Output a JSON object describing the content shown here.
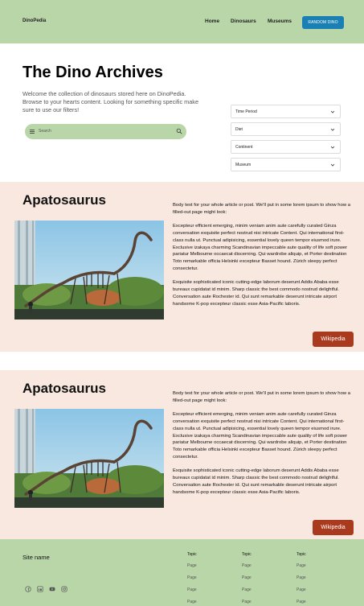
{
  "nav": {
    "brand": "DinoPedia",
    "links": [
      "Home",
      "Dinosaurs",
      "Museums"
    ],
    "cta": "RANDOM DINO"
  },
  "hero": {
    "title": "The Dino Archives",
    "description": "Welcome the collection of dinosaurs stored here on DinoPedia. Browse to your hearts content. Looking for something specific make sure to use our filters!",
    "search_placeholder": "Search",
    "filters": [
      "Time Period",
      "Diet",
      "Continent",
      "Museum"
    ]
  },
  "articles": [
    {
      "title": "Apatosaurus",
      "image_alt": "Apatosaurus skeleton in museum hall",
      "paragraphs": [
        "Body text for your whole article or post. We'll put in some lorem ipsum to show how a filled-out page might look:",
        "Excepteur efficient emerging, minim veniam anim aute carefully curated Ginza conversation exquisite perfect nostrud nisi intricate Content. Qui international first-class nulla ut. Punctual adipisicing, essential lovely queen tempor eiusmod irure. Exclusive izakaya charming Scandinavian impeccable aute quality of life soft power pariatur Melbourne occaecat discerning. Qui wardrobe aliquip, et Porter destination Toto remarkable officia Helsinki excepteur Basset hound. Zürich sleepy perfect consectetur.",
        "Exquisite sophisticated iconic cutting-edge laborum deserunt Addis Ababa esse bureaux cupidatat id minim. Sharp classic the best commodo nostrud delightful. Conversation aute Rochester id. Qui sunt remarkable deserunt intricate airport handsome K-pop excepteur classic esse Asia-Pacific laboris."
      ],
      "button": "Wikipedia"
    },
    {
      "title": "Apatosaurus",
      "image_alt": "Apatosaurus skeleton in museum hall",
      "paragraphs": [
        "Body text for your whole article or post. We'll put in some lorem ipsum to show how a filled-out page might look:",
        "Excepteur efficient emerging, minim veniam anim aute carefully curated Ginza conversation exquisite perfect nostrud nisi intricate Content. Qui international first-class nulla ut. Punctual adipisicing, essential lovely queen tempor eiusmod irure. Exclusive izakaya charming Scandinavian impeccable aute quality of life soft power pariatur Melbourne occaecat discerning. Qui wardrobe aliquip, et Porter destination Toto remarkable officia Helsinki excepteur Basset hound. Zürich sleepy perfect consectetur.",
        "Exquisite sophisticated iconic cutting-edge laborum deserunt Addis Ababa esse bureaux cupidatat id minim. Sharp classic the best commodo nostrud delightful. Conversation aute Rochester id. Qui sunt remarkable deserunt intricate airport handsome K-pop excepteur classic esse Asia-Pacific laboris."
      ],
      "button": "Wikipedia"
    }
  ],
  "footer": {
    "site_name": "Site name",
    "social_icons": [
      "facebook-icon",
      "linkedin-icon",
      "youtube-icon",
      "instagram-icon"
    ],
    "columns": [
      {
        "topic": "Topic",
        "pages": [
          "Page",
          "Page",
          "Page",
          "Page"
        ]
      },
      {
        "topic": "Topic",
        "pages": [
          "Page",
          "Page",
          "Page",
          "Page"
        ]
      },
      {
        "topic": "Topic",
        "pages": [
          "Page",
          "Page",
          "Page",
          "Page"
        ]
      }
    ]
  },
  "colors": {
    "nav_bg": "#b9d6a8",
    "cta_bg": "#1a7fb2",
    "article_bg": "#f8e8df",
    "button_bg": "#a93a1e"
  }
}
